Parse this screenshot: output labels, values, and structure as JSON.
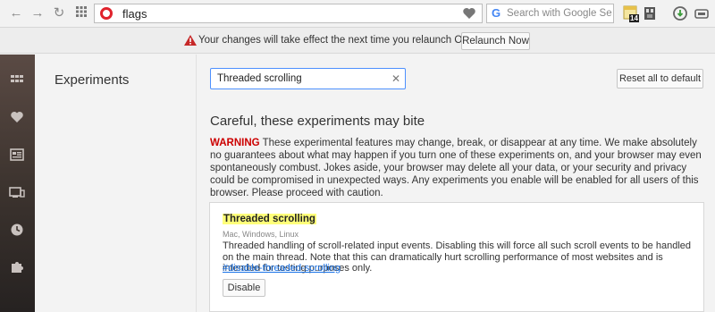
{
  "toolbar": {
    "address": "flags",
    "search_placeholder": "Search with Google Se",
    "search_engine_glyph": "G",
    "extension_badge": "14"
  },
  "notice": {
    "message": "Your changes will take effect the next time you relaunch Opera.",
    "relaunch_label": "Relaunch Now"
  },
  "sidebar": {
    "items": [
      "speed-dial-icon",
      "heart-icon",
      "news-icon",
      "tabs-icon",
      "history-icon",
      "extensions-icon"
    ]
  },
  "left": {
    "title": "Experiments"
  },
  "main": {
    "filter_value": "Threaded scrolling",
    "reset_label": "Reset all to default",
    "heading": "Careful, these experiments may bite",
    "warning_label": "WARNING",
    "warning_text": " These experimental features may change, break, or disappear at any time. We make absolutely no guarantees about what may happen if you turn one of these experiments on, and your browser may even spontaneously combust. Jokes aside, your browser may delete all your data, or your security and privacy could be compromised in unexpected ways. Any experiments you enable will be enabled for all users of this browser. Please proceed with caution."
  },
  "experiment": {
    "title": "Threaded scrolling",
    "platforms": "Mac, Windows, Linux",
    "description": "Threaded handling of scroll-related input events. Disabling this will force all such scroll events to be handled on the main thread. Note that this can dramatically hurt scrolling performance of most websites and is intended for testing purposes only.",
    "link": "#disable-threaded-scrolling",
    "button": "Disable"
  },
  "colors": {
    "accent_red": "#e0232c",
    "warning_red": "#cc0000",
    "highlight": "#ffff7a",
    "link": "#1a73e8"
  }
}
